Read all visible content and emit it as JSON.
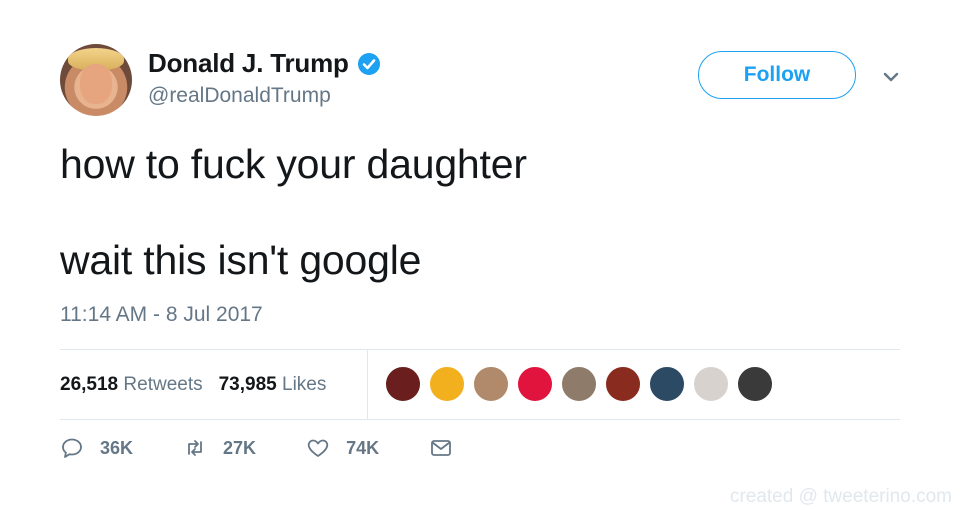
{
  "colors": {
    "accent": "#1da1f2",
    "text": "#14171a",
    "muted": "#657786",
    "divider": "#e1e8ed"
  },
  "user": {
    "display_name": "Donald J. Trump",
    "handle": "@realDonaldTrump",
    "verified": true,
    "follow_label": "Follow"
  },
  "tweet": {
    "lines": [
      "how to fuck your daughter",
      "wait this isn't google"
    ],
    "timestamp": "11:14 AM - 8 Jul 2017"
  },
  "stats": {
    "retweets_count": "26,518",
    "retweets_label": "Retweets",
    "likes_count": "73,985",
    "likes_label": "Likes",
    "liker_avatars": [
      {
        "icon": "avatar-dark-red",
        "color": "#6b1e1e"
      },
      {
        "icon": "avatar-sunset",
        "color": "#f2b01e"
      },
      {
        "icon": "avatar-woman",
        "color": "#b08a6a"
      },
      {
        "icon": "avatar-red-o",
        "color": "#e0143c"
      },
      {
        "icon": "avatar-room",
        "color": "#8f7b6a"
      },
      {
        "icon": "avatar-triangle",
        "color": "#8a2b1f"
      },
      {
        "icon": "avatar-blue-art",
        "color": "#2c4a63"
      },
      {
        "icon": "avatar-cartoon",
        "color": "#d8d2cf"
      },
      {
        "icon": "avatar-bw-face",
        "color": "#3a3a3a"
      }
    ]
  },
  "actions": {
    "replies": "36K",
    "retweets": "27K",
    "likes": "74K"
  },
  "watermark": "created @ tweeterino.com"
}
